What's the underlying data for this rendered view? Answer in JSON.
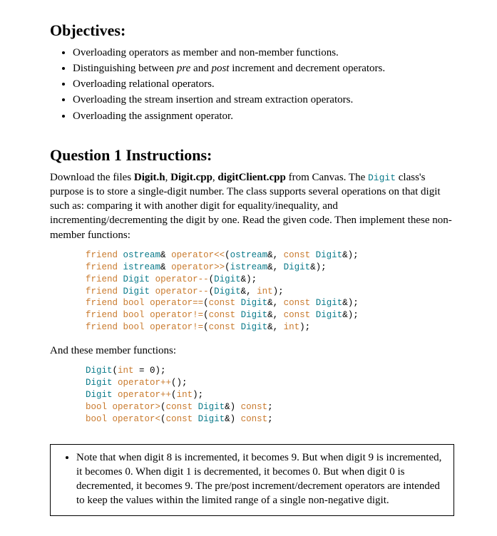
{
  "objectives": {
    "heading": "Objectives:",
    "items": [
      {
        "text": "Overloading operators as member and non-member functions."
      },
      {
        "prefix": "Distinguishing between ",
        "em1": "pre",
        "mid": " and ",
        "em2": "post",
        "suffix": " increment and decrement operators."
      },
      {
        "text": "Overloading relational operators."
      },
      {
        "text": "Overloading the stream insertion and stream extraction operators."
      },
      {
        "text": "Overloading the assignment operator."
      }
    ]
  },
  "q1": {
    "heading": "Question 1 Instructions:",
    "intro_prefix": "Download the files ",
    "file1": "Digit.h",
    "sep1": ", ",
    "file2": "Digit.cpp",
    "sep2": ", ",
    "file3": "digitClient.cpp",
    "intro_mid": " from Canvas.  The ",
    "class_name": "Digit",
    "intro_suffix": " class's purpose is to store a single-digit number.  The class supports several operations on that digit such as: comparing it with another digit for equality/inequality, and incrementing/decrementing the digit by one.  Read the given code.  Then implement these non-member functions:",
    "nonmember_code": "friend ostream& operator<<(ostream&, const Digit&);\nfriend istream& operator>>(istream&, Digit&);\nfriend Digit operator--(Digit&);\nfriend Digit operator--(Digit&, int);\nfriend bool operator==(const Digit&, const Digit&);\nfriend bool operator!=(const Digit&, const Digit&);\nfriend bool operator!=(const Digit&, int);",
    "member_intro": "And these member functions:",
    "member_code": "Digit(int = 0);\nDigit operator++();\nDigit operator++(int);\nbool operator>(const Digit&) const;\nbool operator<(const Digit&) const;"
  },
  "note": {
    "text": "Note that when digit 8 is incremented, it becomes 9.  But when digit 9 is incremented, it becomes 0.  When digit 1 is decremented, it becomes 0.  But when digit 0 is decremented, it becomes 9.  The pre/post increment/decrement operators are intended to keep the values within the limited range of a single non-negative digit."
  },
  "chart_data": null
}
